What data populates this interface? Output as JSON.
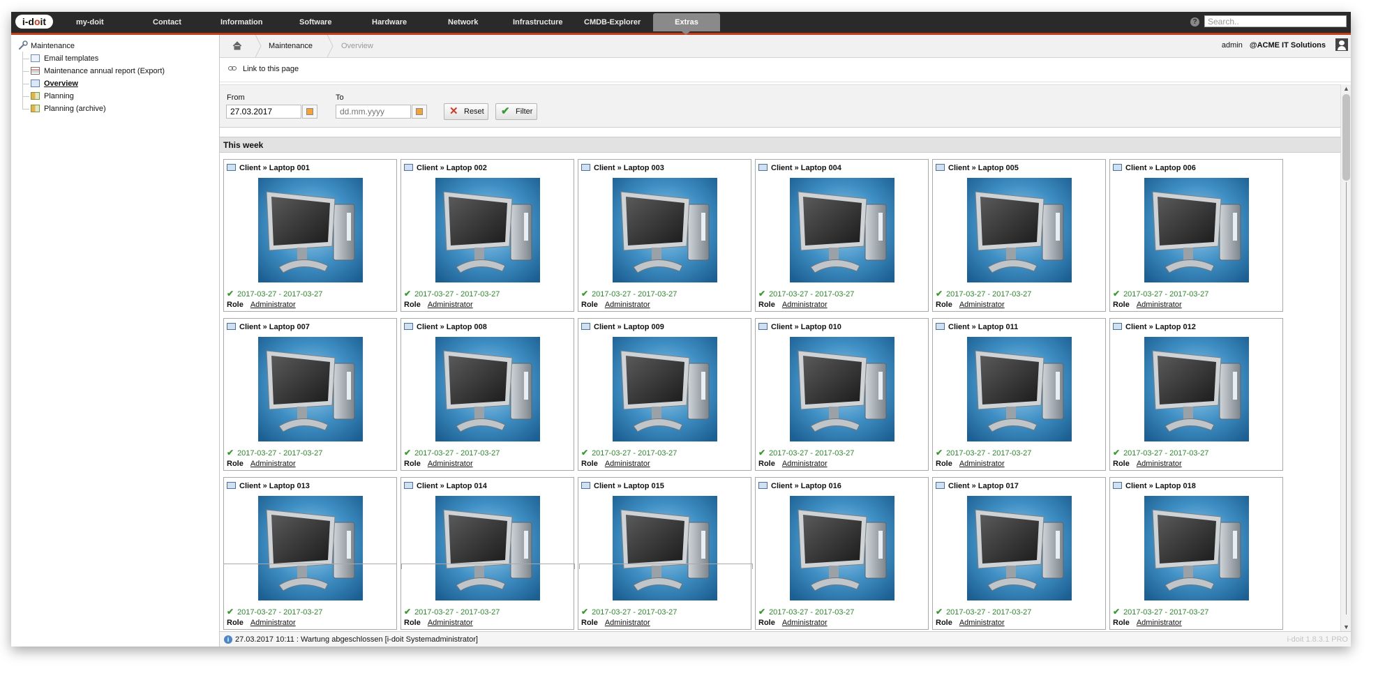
{
  "app": {
    "logo_text_1": "i-d",
    "logo_text_2": "o",
    "logo_text_3": "it"
  },
  "nav": {
    "items": [
      {
        "label": "my-doit"
      },
      {
        "label": "Contact"
      },
      {
        "label": "Information"
      },
      {
        "label": "Software"
      },
      {
        "label": "Hardware"
      },
      {
        "label": "Network"
      },
      {
        "label": "Infrastructure"
      },
      {
        "label": "CMDB-Explorer"
      },
      {
        "label": "Extras"
      }
    ],
    "active": "Extras",
    "search_placeholder": "Search..",
    "help_glyph": "?"
  },
  "sidebar": {
    "root": {
      "label": "Maintenance",
      "icon": "wrench-icon"
    },
    "items": [
      {
        "label": "Email templates",
        "icon": "mail-icon"
      },
      {
        "label": "Maintenance annual report (Export)",
        "icon": "report-icon"
      },
      {
        "label": "Overview",
        "icon": "overview-icon",
        "active": true
      },
      {
        "label": "Planning",
        "icon": "planning-icon"
      },
      {
        "label": "Planning (archive)",
        "icon": "planning-archive-icon"
      }
    ]
  },
  "breadcrumb": {
    "home_icon": "home-icon",
    "items": [
      "Maintenance",
      "Overview"
    ]
  },
  "user": {
    "name": "admin",
    "tenant": "@ACME IT Solutions"
  },
  "link_to_page": "Link to this page",
  "filter": {
    "from_label": "From",
    "from_value": "27.03.2017",
    "to_label": "To",
    "to_placeholder": "dd.mm.yyyy",
    "reset_label": "Reset",
    "filter_label": "Filter"
  },
  "section_title": "This week",
  "cards": [
    {
      "title": "Client » Laptop 001",
      "dates": "2017-03-27 - 2017-03-27",
      "role_label": "Role",
      "role": "Administrator"
    },
    {
      "title": "Client » Laptop 002",
      "dates": "2017-03-27 - 2017-03-27",
      "role_label": "Role",
      "role": "Administrator"
    },
    {
      "title": "Client » Laptop 003",
      "dates": "2017-03-27 - 2017-03-27",
      "role_label": "Role",
      "role": "Administrator"
    },
    {
      "title": "Client » Laptop 004",
      "dates": "2017-03-27 - 2017-03-27",
      "role_label": "Role",
      "role": "Administrator"
    },
    {
      "title": "Client » Laptop 005",
      "dates": "2017-03-27 - 2017-03-27",
      "role_label": "Role",
      "role": "Administrator"
    },
    {
      "title": "Client » Laptop 006",
      "dates": "2017-03-27 - 2017-03-27",
      "role_label": "Role",
      "role": "Administrator"
    },
    {
      "title": "Client » Laptop 007",
      "dates": "2017-03-27 - 2017-03-27",
      "role_label": "Role",
      "role": "Administrator"
    },
    {
      "title": "Client » Laptop 008",
      "dates": "2017-03-27 - 2017-03-27",
      "role_label": "Role",
      "role": "Administrator"
    },
    {
      "title": "Client » Laptop 009",
      "dates": "2017-03-27 - 2017-03-27",
      "role_label": "Role",
      "role": "Administrator"
    },
    {
      "title": "Client » Laptop 010",
      "dates": "2017-03-27 - 2017-03-27",
      "role_label": "Role",
      "role": "Administrator"
    },
    {
      "title": "Client » Laptop 011",
      "dates": "2017-03-27 - 2017-03-27",
      "role_label": "Role",
      "role": "Administrator"
    },
    {
      "title": "Client » Laptop 012",
      "dates": "2017-03-27 - 2017-03-27",
      "role_label": "Role",
      "role": "Administrator"
    },
    {
      "title": "Client » Laptop 013",
      "dates": "2017-03-27 - 2017-03-27",
      "role_label": "Role",
      "role": "Administrator"
    },
    {
      "title": "Client » Laptop 014",
      "dates": "2017-03-27 - 2017-03-27",
      "role_label": "Role",
      "role": "Administrator"
    },
    {
      "title": "Client » Laptop 015",
      "dates": "2017-03-27 - 2017-03-27",
      "role_label": "Role",
      "role": "Administrator"
    },
    {
      "title": "Client » Laptop 016",
      "dates": "2017-03-27 - 2017-03-27",
      "role_label": "Role",
      "role": "Administrator"
    },
    {
      "title": "Client » Laptop 017",
      "dates": "2017-03-27 - 2017-03-27",
      "role_label": "Role",
      "role": "Administrator"
    },
    {
      "title": "Client » Laptop 018",
      "dates": "2017-03-27 - 2017-03-27",
      "role_label": "Role",
      "role": "Administrator"
    }
  ],
  "status": {
    "message": "27.03.2017 10:11 : Wartung abgeschlossen [i-doit Systemadministrator]",
    "version": "i-doit 1.8.3.1 PRO"
  },
  "colors": {
    "topbar": "#2a2a2a",
    "accent": "#c23d1b",
    "success": "#2b8a2b",
    "active_tab": "#8a8a8a"
  }
}
